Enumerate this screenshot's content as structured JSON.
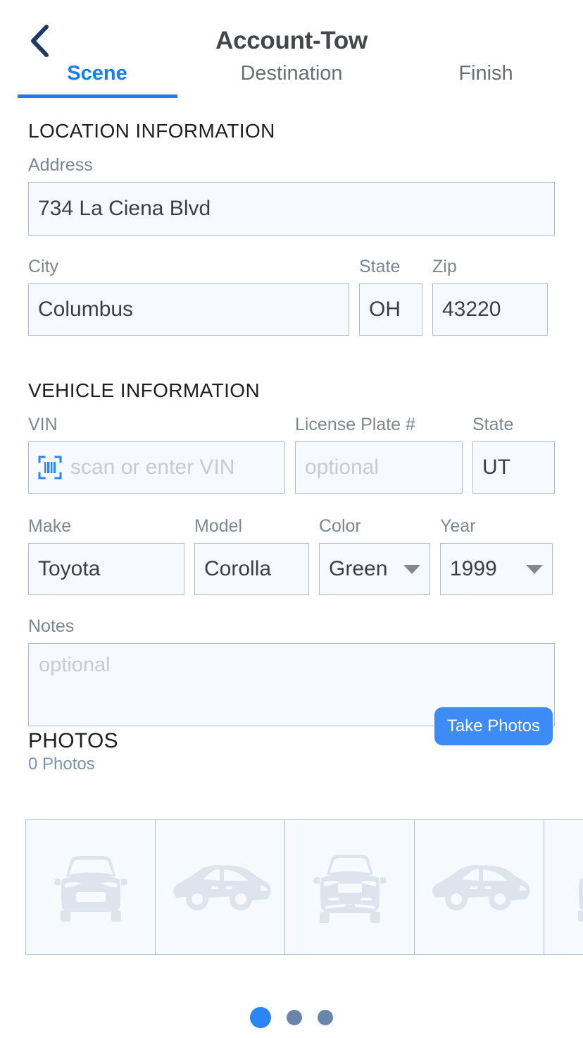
{
  "header": {
    "title": "Account-Tow",
    "back_icon": "chevron-left-icon",
    "tabs": [
      {
        "label": "Scene",
        "active": true
      },
      {
        "label": "Destination",
        "active": false
      },
      {
        "label": "Finish",
        "active": false
      }
    ]
  },
  "location": {
    "section_title": "LOCATION INFORMATION",
    "address": {
      "label": "Address",
      "value": "734 La Ciena Blvd"
    },
    "city": {
      "label": "City",
      "value": "Columbus"
    },
    "state": {
      "label": "State",
      "value": "OH"
    },
    "zip": {
      "label": "Zip",
      "value": "43220"
    }
  },
  "vehicle": {
    "section_title": "VEHICLE INFORMATION",
    "vin": {
      "label": "VIN",
      "value": "",
      "placeholder": "scan or enter VIN",
      "icon": "barcode-scan-icon"
    },
    "license_plate": {
      "label": "License Plate #",
      "value": "",
      "placeholder": "optional"
    },
    "state": {
      "label": "State",
      "value": "UT"
    },
    "make": {
      "label": "Make",
      "value": "Toyota"
    },
    "model": {
      "label": "Model",
      "value": "Corolla"
    },
    "color": {
      "label": "Color",
      "value": "Green"
    },
    "year": {
      "label": "Year",
      "value": "1999"
    }
  },
  "notes": {
    "label": "Notes",
    "value": "",
    "placeholder": "optional"
  },
  "photos": {
    "title": "PHOTOS",
    "count_label": "0 Photos",
    "take_photos_label": "Take Photos",
    "thumbnails": [
      {
        "name": "car-front-placeholder"
      },
      {
        "name": "car-side-placeholder"
      },
      {
        "name": "car-rear-placeholder"
      },
      {
        "name": "car-side-placeholder"
      },
      {
        "name": "car-front-placeholder"
      }
    ]
  },
  "pagination": {
    "total": 3,
    "active_index": 0
  },
  "colors": {
    "accent": "#1a7ced",
    "button": "#3d8bf7",
    "field_bg": "#f6f9fd",
    "field_border": "#adbccf",
    "label": "#7e868f",
    "back_icon": "#1e3a63"
  }
}
